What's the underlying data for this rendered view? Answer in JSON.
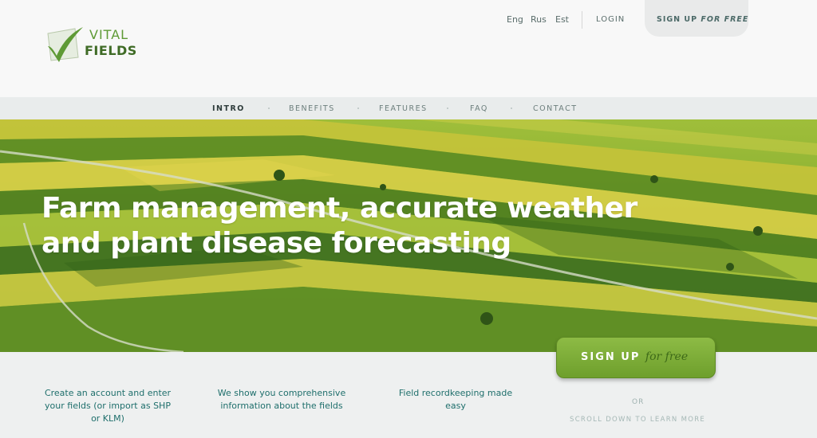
{
  "brand": {
    "logo_text_line1": "VITAL",
    "logo_text_line2": "FIELDS",
    "primary_color": "#5e9a35"
  },
  "header": {
    "languages": [
      "Eng",
      "Rus",
      "Est"
    ],
    "login_label": "LOGIN",
    "signup_label": "SIGN UP",
    "signup_suffix": "FOR FREE"
  },
  "nav": {
    "items": [
      {
        "label": "INTRO",
        "active": true
      },
      {
        "label": "BENEFITS",
        "active": false
      },
      {
        "label": "FEATURES",
        "active": false
      },
      {
        "label": "FAQ",
        "active": false
      },
      {
        "label": "CONTACT",
        "active": false
      }
    ]
  },
  "hero": {
    "headline_line1": "Farm management, accurate weather",
    "headline_line2": "and plant disease forecasting",
    "image": "aerial-farm-fields"
  },
  "features": [
    {
      "line1": "Create an account and enter",
      "line2": "your fields (or import as SHP",
      "line3": "or KLM)"
    },
    {
      "line1": "We show you comprehensive",
      "line2": "information about the fields",
      "line3": ""
    },
    {
      "line1": "Field recordkeeping made",
      "line2": "easy",
      "line3": ""
    }
  ],
  "cta": {
    "label": "SIGN UP",
    "suffix": "for free",
    "or_text": "OR",
    "scroll_text": "SCROLL DOWN TO LEARN MORE"
  }
}
